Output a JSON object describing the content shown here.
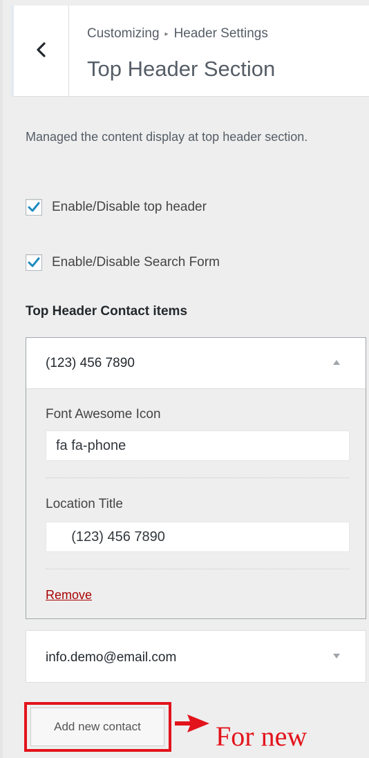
{
  "header": {
    "back_icon": "chevron-left-icon",
    "breadcrumb_root": "Customizing",
    "breadcrumb_separator": "▸",
    "breadcrumb_parent": "Header Settings",
    "section_title": "Top Header Section"
  },
  "description": "Managed the content display at top header section.",
  "options": [
    {
      "label": "Enable/Disable top header",
      "checked": true
    },
    {
      "label": "Enable/Disable Search Form",
      "checked": true
    }
  ],
  "contact_group": {
    "label": "Top Header Contact items",
    "items": [
      {
        "title": "(123) 456 7890",
        "expanded": true,
        "icon_field_label": "Font Awesome Icon",
        "icon_field_value": "fa fa-phone",
        "title_field_label": "Location Title",
        "title_field_value": "    (123) 456 7890",
        "remove_label": "Remove"
      },
      {
        "title": "info.demo@email.com",
        "expanded": false
      }
    ],
    "add_button_label": "Add new contact"
  },
  "annotation": {
    "text": "For new",
    "color": "#e3131b"
  },
  "colors": {
    "accent_check": "#1e8cbe",
    "remove_link": "#aa0000",
    "annotation_red": "#e3131b"
  }
}
